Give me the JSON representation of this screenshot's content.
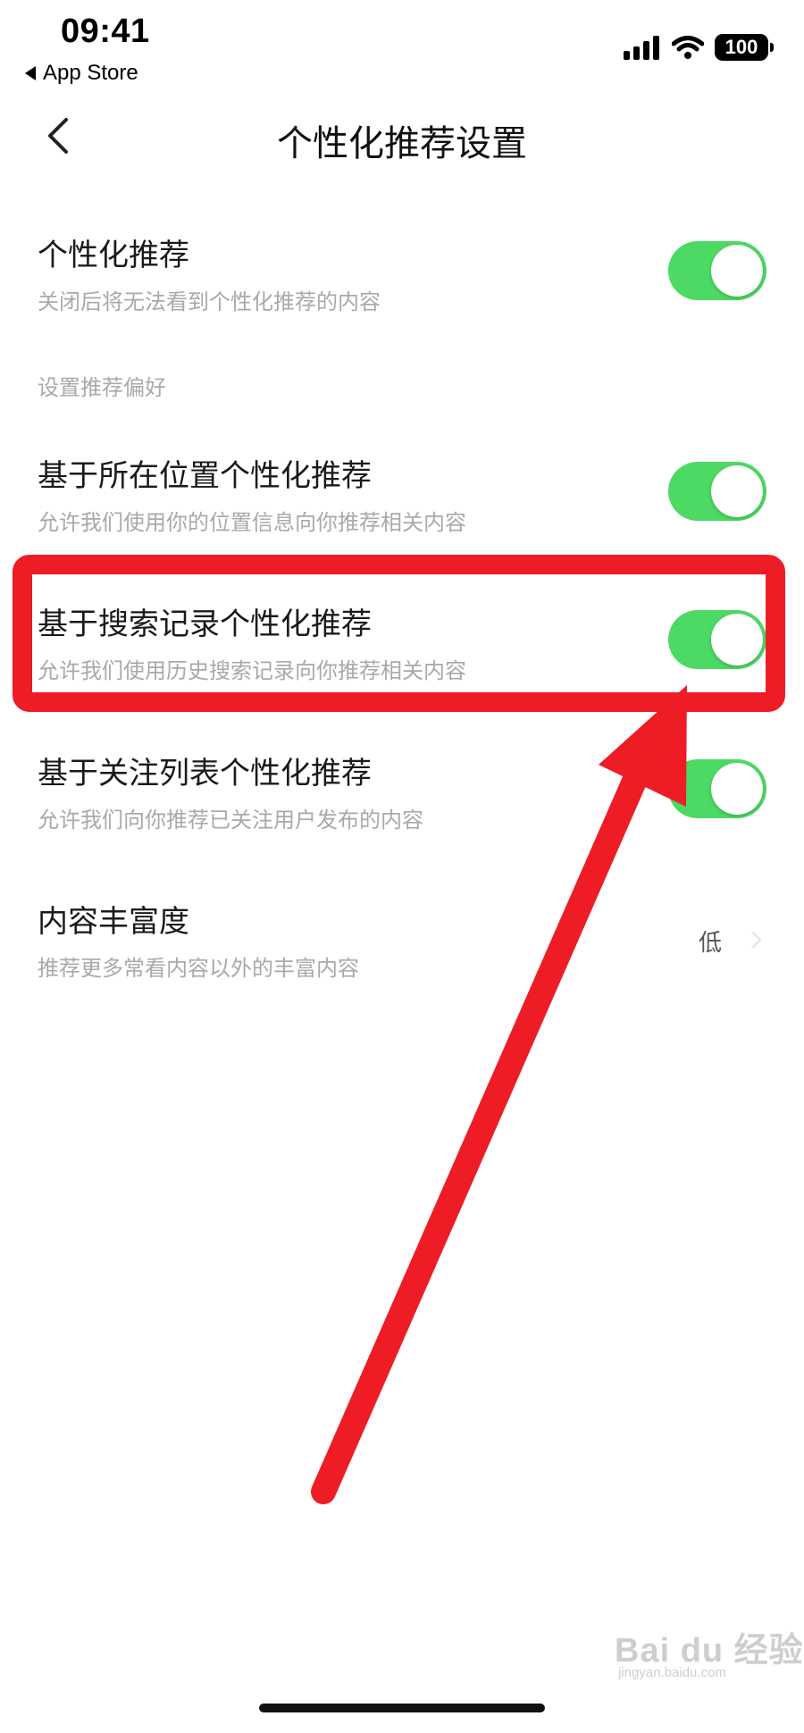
{
  "status_bar": {
    "time": "09:41",
    "back_app": "App Store",
    "battery": "100",
    "icons": [
      "signal-icon",
      "wifi-icon",
      "battery-icon"
    ]
  },
  "nav": {
    "title": "个性化推荐设置",
    "back_icon": "chevron-left-icon"
  },
  "settings": {
    "personalized": {
      "title": "个性化推荐",
      "desc": "关闭后将无法看到个性化推荐的内容",
      "enabled": true
    },
    "section_header": "设置推荐偏好",
    "location": {
      "title": "基于所在位置个性化推荐",
      "desc": "允许我们使用你的位置信息向你推荐相关内容",
      "enabled": true
    },
    "search_history": {
      "title": "基于搜索记录个性化推荐",
      "desc": "允许我们使用历史搜索记录向你推荐相关内容",
      "enabled": true
    },
    "follow_list": {
      "title": "基于关注列表个性化推荐",
      "desc": "允许我们向你推荐已关注用户发布的内容",
      "enabled": true
    },
    "richness": {
      "title": "内容丰富度",
      "desc": "推荐更多常看内容以外的丰富内容",
      "value": "低"
    }
  },
  "colors": {
    "toggle_on": "#4cd964",
    "annotation": "#ee1c25"
  },
  "watermark": {
    "main": "Bai du 经验",
    "url": "jingyan.baidu.com"
  }
}
